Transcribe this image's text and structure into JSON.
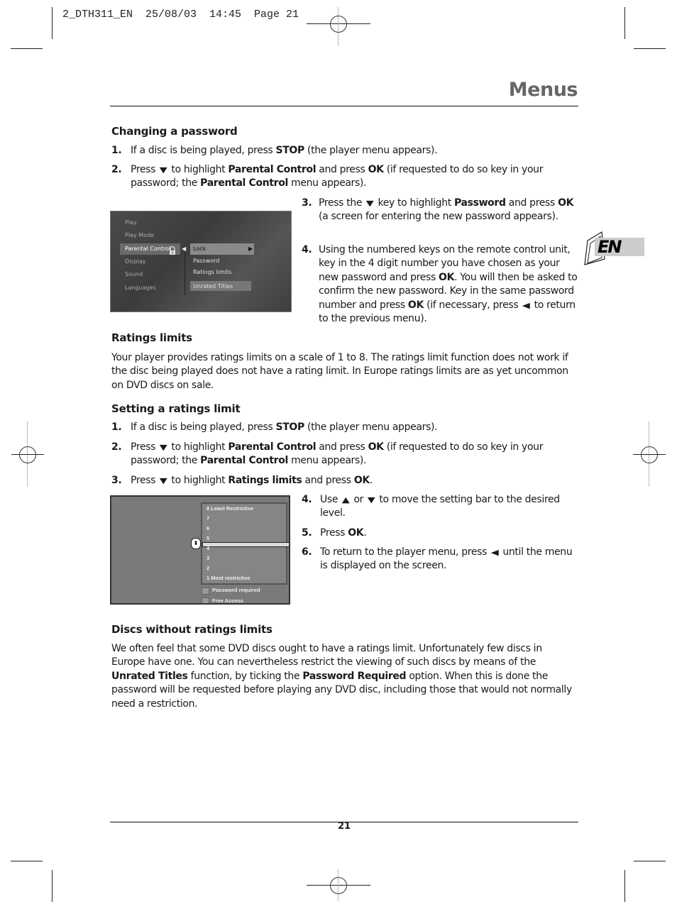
{
  "slug": "2_DTH311_EN  25/08/03  14:45  Page 21",
  "header": {
    "title": "Menus"
  },
  "language_tab": {
    "label": "EN"
  },
  "sections": {
    "changing_password": {
      "heading": "Changing a password",
      "steps": [
        {
          "num": "1.",
          "parts": [
            "If a disc is being played, press ",
            "STOP",
            " (the player menu appears)."
          ]
        },
        {
          "num": "2.",
          "parts": [
            "Press ",
            "▼",
            " to highlight ",
            "Parental Control",
            " and press ",
            "OK",
            " (if requested to do so key in your password; the ",
            "Parental Control",
            " menu appears)."
          ]
        },
        {
          "num": "3.",
          "parts": [
            "Press the ",
            "▼",
            " key to highlight ",
            "Password",
            " and press ",
            "OK",
            " (a screen for entering the new password appears)."
          ]
        },
        {
          "num": "4.",
          "parts": [
            "Using the numbered keys on the remote control unit, key in the 4 digit number you have chosen as your new password and press ",
            "OK",
            ". You will then be asked to confirm the new password. Key in the same password number and press ",
            "OK",
            " (if necessary, press ",
            "◀",
            " to return to the previous menu)."
          ]
        }
      ]
    },
    "ratings_limits": {
      "heading": "Ratings limits",
      "body": "Your player provides ratings limits on a scale of 1 to 8. The ratings limit function does not work if the disc being played does not have a rating limit. In Europe ratings limits are as yet uncommon on DVD discs on sale."
    },
    "setting_limit": {
      "heading": "Setting a ratings limit",
      "steps": [
        {
          "num": "1.",
          "parts": [
            "If a disc is being played, press ",
            "STOP",
            " (the player menu appears)."
          ]
        },
        {
          "num": "2.",
          "parts": [
            "Press ",
            "▼",
            " to highlight ",
            "Parental Control",
            " and press ",
            "OK",
            " (if requested to do so key in your password; the ",
            "Parental Control",
            " menu appears)."
          ]
        },
        {
          "num": "3.",
          "parts": [
            "Press ",
            "▼",
            " to highlight ",
            "Ratings limits",
            " and press ",
            "OK",
            "."
          ]
        },
        {
          "num": "4.",
          "parts": [
            "Use ",
            "▲",
            " or ",
            "▼",
            " to move the setting bar to the desired level."
          ]
        },
        {
          "num": "5.",
          "parts": [
            "Press ",
            "OK",
            "."
          ]
        },
        {
          "num": "6.",
          "parts": [
            "To return to the player menu, press ",
            "◀",
            " until the menu is displayed on the screen."
          ]
        }
      ]
    },
    "discs_without": {
      "heading": "Discs without ratings limits",
      "parts": [
        "We often feel that some DVD discs ought to have a ratings limit. Unfortunately few discs in Europe have one. You can nevertheless restrict the viewing of such discs by means of the ",
        "Unrated Titles",
        " function, by ticking the ",
        "Password Required",
        " option. When this is done the password will be requested before playing any DVD disc, including those that would not normally need a restriction."
      ]
    }
  },
  "screen_parental": {
    "menu": [
      "Play",
      "Play Mode",
      "Parental Control",
      "Display",
      "Sound",
      "Languages"
    ],
    "selected_menu": "Parental Control",
    "submenu": [
      "Lock",
      "Password",
      "Ratings limits",
      "Unrated Titles"
    ],
    "selected_submenu": "Lock"
  },
  "screen_ratings": {
    "levels": [
      "8 Least Restrictive",
      "7",
      "6",
      "5",
      "4",
      "3",
      "2",
      "1 Most restrictive"
    ],
    "current_level_between": "5 and 4",
    "options": [
      "Password required",
      "Free Access"
    ]
  },
  "footer": {
    "page_number": "21"
  }
}
